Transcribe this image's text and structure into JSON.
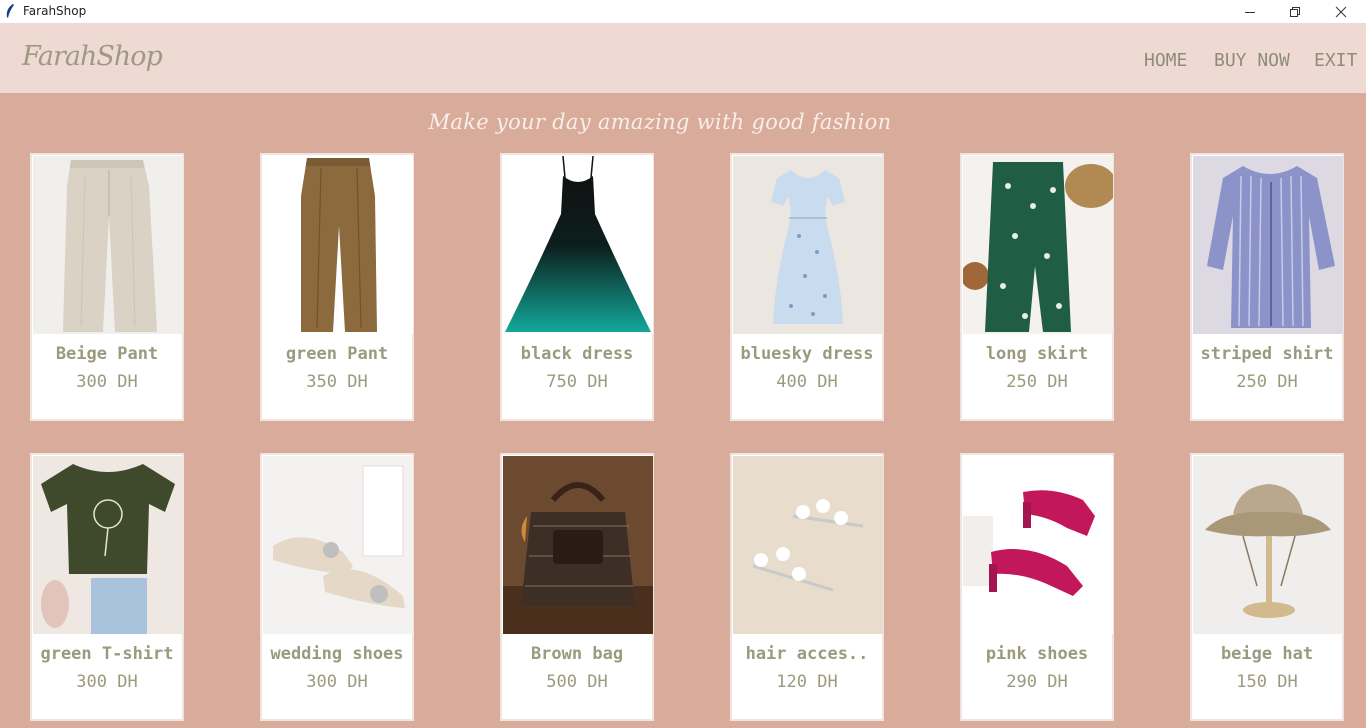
{
  "window": {
    "title": "FarahShop"
  },
  "header": {
    "logo": "FarahShop",
    "nav": [
      "HOME",
      "BUY NOW",
      "EXIT"
    ]
  },
  "tagline": "Make your day amazing with good fashion",
  "colors": {
    "background": "#d8ab9b",
    "header": "#efdad3",
    "text": "#9b9a7e"
  },
  "products": [
    {
      "name": "Beige Pant",
      "price": "300 DH",
      "icon": "beige-pants-image"
    },
    {
      "name": "green Pant",
      "price": "350 DH",
      "icon": "green-pants-image"
    },
    {
      "name": "black dress",
      "price": "750 DH",
      "icon": "black-dress-image"
    },
    {
      "name": "bluesky dress",
      "price": "400 DH",
      "icon": "bluesky-dress-image"
    },
    {
      "name": "long skirt",
      "price": "250 DH",
      "icon": "long-skirt-image"
    },
    {
      "name": "striped shirt",
      "price": "250 DH",
      "icon": "striped-shirt-image"
    },
    {
      "name": "green T-shirt",
      "price": "300 DH",
      "icon": "green-tshirt-image"
    },
    {
      "name": "wedding shoes",
      "price": "300 DH",
      "icon": "wedding-shoes-image"
    },
    {
      "name": "Brown bag",
      "price": "500 DH",
      "icon": "brown-bag-image"
    },
    {
      "name": "hair acces..",
      "price": "120 DH",
      "icon": "hair-accessory-image"
    },
    {
      "name": "pink shoes",
      "price": "290 DH",
      "icon": "pink-shoes-image"
    },
    {
      "name": "beige hat",
      "price": "150 DH",
      "icon": "beige-hat-image"
    }
  ]
}
